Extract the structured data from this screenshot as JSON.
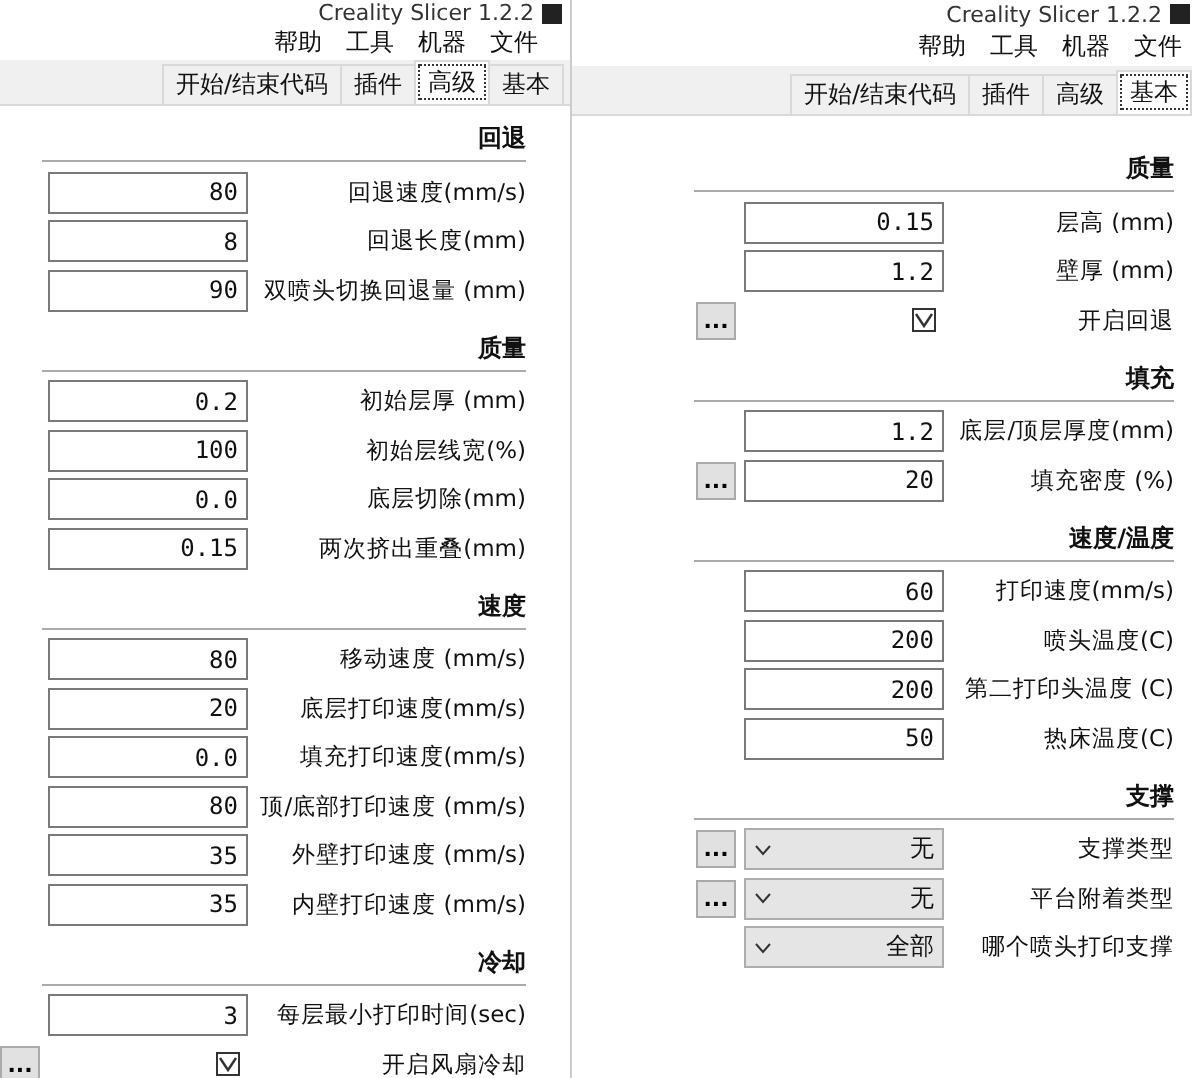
{
  "windows": [
    {
      "title": "Creality Slicer 1.2.2",
      "menu": [
        "帮助",
        "工具",
        "机器",
        "文件"
      ],
      "tabs": [
        {
          "label": "开始/结束代码",
          "selected": false
        },
        {
          "label": "插件",
          "selected": false
        },
        {
          "label": "高级",
          "selected": true
        },
        {
          "label": "基本",
          "selected": false
        }
      ],
      "sections": [
        {
          "title": "回退",
          "rows": [
            {
              "kind": "input",
              "label": "回退速度(mm/s)",
              "value": "80"
            },
            {
              "kind": "input",
              "label": "回退长度(mm)",
              "value": "8"
            },
            {
              "kind": "input",
              "label": "双喷头切换回退量 (mm)",
              "value": "90"
            }
          ]
        },
        {
          "title": "质量",
          "rows": [
            {
              "kind": "input",
              "label": "初始层厚 (mm)",
              "value": "0.2"
            },
            {
              "kind": "input",
              "label": "初始层线宽(%)",
              "value": "100"
            },
            {
              "kind": "input",
              "label": "底层切除(mm)",
              "value": "0.0"
            },
            {
              "kind": "input",
              "label": "两次挤出重叠(mm)",
              "value": "0.15"
            }
          ]
        },
        {
          "title": "速度",
          "rows": [
            {
              "kind": "input",
              "label": "移动速度 (mm/s)",
              "value": "80"
            },
            {
              "kind": "input",
              "label": "底层打印速度(mm/s)",
              "value": "20"
            },
            {
              "kind": "input",
              "label": "填充打印速度(mm/s)",
              "value": "0.0"
            },
            {
              "kind": "input",
              "label": "顶/底部打印速度 (mm/s)",
              "value": "80"
            },
            {
              "kind": "input",
              "label": "外壁打印速度 (mm/s)",
              "value": "35"
            },
            {
              "kind": "input",
              "label": "内壁打印速度 (mm/s)",
              "value": "35"
            }
          ]
        },
        {
          "title": "冷却",
          "rows": [
            {
              "kind": "input",
              "label": "每层最小打印时间(sec)",
              "value": "3"
            },
            {
              "kind": "checkbox",
              "label": "开启风扇冷却",
              "checked": true,
              "more_button": "..."
            }
          ]
        }
      ]
    },
    {
      "title": "Creality Slicer 1.2.2",
      "menu": [
        "帮助",
        "工具",
        "机器",
        "文件"
      ],
      "tabs": [
        {
          "label": "开始/结束代码",
          "selected": false
        },
        {
          "label": "插件",
          "selected": false
        },
        {
          "label": "高级",
          "selected": false
        },
        {
          "label": "基本",
          "selected": true
        }
      ],
      "sections": [
        {
          "title": "质量",
          "rows": [
            {
              "kind": "input",
              "label": "层高 (mm)",
              "value": "0.15"
            },
            {
              "kind": "input",
              "label": "壁厚 (mm)",
              "value": "1.2"
            },
            {
              "kind": "checkbox",
              "label": "开启回退",
              "checked": true,
              "more_button": "..."
            }
          ]
        },
        {
          "title": "填充",
          "rows": [
            {
              "kind": "input",
              "label": "底层/顶层厚度(mm)",
              "value": "1.2"
            },
            {
              "kind": "input",
              "label": "填充密度 (%)",
              "value": "20",
              "more_button": "..."
            }
          ]
        },
        {
          "title": "速度/温度",
          "rows": [
            {
              "kind": "input",
              "label": "打印速度(mm/s)",
              "value": "60"
            },
            {
              "kind": "input",
              "label": "喷头温度(C)",
              "value": "200"
            },
            {
              "kind": "input",
              "label": "第二打印头温度 (C)",
              "value": "200"
            },
            {
              "kind": "input",
              "label": "热床温度(C)",
              "value": "50"
            }
          ]
        },
        {
          "title": "支撑",
          "rows": [
            {
              "kind": "select",
              "label": "支撑类型",
              "value": "无",
              "more_button": "..."
            },
            {
              "kind": "select",
              "label": "平台附着类型",
              "value": "无",
              "more_button": "..."
            },
            {
              "kind": "select",
              "label": "哪个喷头打印支撑",
              "value": "全部"
            }
          ]
        }
      ]
    }
  ]
}
